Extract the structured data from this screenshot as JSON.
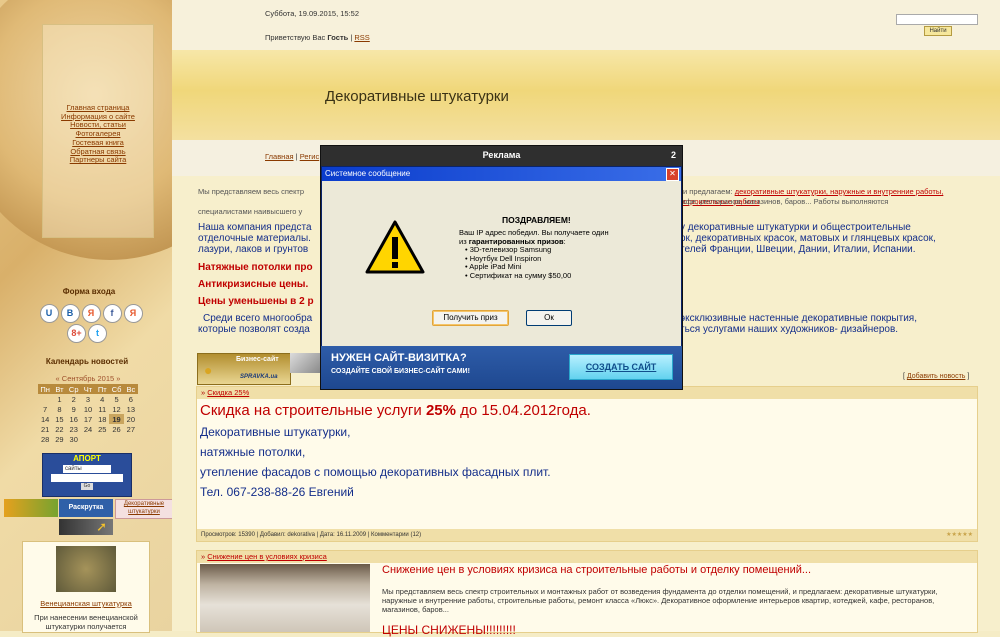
{
  "header": {
    "datetime": "Суббота, 19.09.2015, 15:52",
    "greeting_prefix": "Приветствую Вас",
    "greeting_user": "Гость",
    "sep": "|",
    "rss": "RSS",
    "search_button": "Найти"
  },
  "banner": {
    "title": "Декоративные штукатурки"
  },
  "nav": {
    "home": "Главная",
    "sep": "|",
    "register_partial": "Регис"
  },
  "menu": {
    "items": [
      "Главная страница",
      "Информация о сайте",
      "Новости, статьи",
      "Фотогалерея",
      "Гостевая книга",
      "Обратная связь",
      "Партнеры сайта"
    ]
  },
  "left": {
    "login_title": "Форма входа",
    "social": [
      "U",
      "B",
      "Я",
      "f",
      "Я",
      "8+",
      "t"
    ],
    "calendar_title": "Календарь новостей",
    "calendar_month": "« Сентябрь 2015 »",
    "calendar_days": [
      "Пн",
      "Вт",
      "Ср",
      "Чт",
      "Пт",
      "Сб",
      "Вс"
    ],
    "calendar_weeks": [
      [
        "",
        "1",
        "2",
        "3",
        "4",
        "5",
        "6"
      ],
      [
        "7",
        "8",
        "9",
        "10",
        "11",
        "12",
        "13"
      ],
      [
        "14",
        "15",
        "16",
        "17",
        "18",
        "19",
        "20"
      ],
      [
        "21",
        "22",
        "23",
        "24",
        "25",
        "26",
        "27"
      ],
      [
        "28",
        "29",
        "30",
        "",
        "",
        "",
        ""
      ]
    ],
    "aport_title": "АПОРТ",
    "aport_select": "сайты",
    "aport_go": "Go",
    "banner_links": [
      "Раскрутка",
      "Декоративные штукатурки"
    ],
    "photo_caption": "Венецианская штукатурка",
    "photo_text": "При нанесении венецианской штукатурки получается"
  },
  "content": {
    "intro": "Мы представляем весь спектр",
    "intro_right": "и предлагаем:",
    "intro_links": "декоративные штукатурки, наружные и внутренние работы, строительные работы",
    "intro_tail": "кафе, ресторанов, магазинов, баров... Работы выполняются",
    "intro_line3": "специалистами наивысшего у",
    "company": "Наша компания предста",
    "company_right": "у декоративные штукатурки и общестроительные",
    "company_l2": "отделочные материалы.",
    "company_l2_right": "ок, декоративных красок, матовых и глянцевых красок,",
    "company_l3": "лазури, лаков и грунтов",
    "company_l3_right": "телей Франции, Швеции, Дании, Италии, Испании.",
    "red1": "Натяжные потолки про",
    "red2": "Антикризисные цены.",
    "red3": "Цены уменьшены в 2 р",
    "blue_p1": "Среди всего многообра",
    "blue_p1_right": "эксклюзивные настенные декоративные покрытия,",
    "blue_p2": "которые позволят созда",
    "blue_p2_right": "ться услугами наших художников- дизайнеров.",
    "badge_title": "Бизнес-сайт",
    "badge_sub": "SPRAVKA.ua",
    "add_news": "Добавить новость",
    "news1": {
      "title": "Скидка 25%",
      "headline_a": "Скидка на строительные услуги",
      "headline_b": "25%",
      "headline_c": "до 15.04.2012года.",
      "lines": [
        "Декоративные штукатурки,",
        "натяжные потолки,",
        "утепление фасадов с помощью декоративных фасадных плит.",
        "Тел. 067-238-88-26 Евгений"
      ],
      "footer": "Просмотров: 15390 | Добавил: dekorativa | Дата: 16.11.2009 | Комментарии (12)",
      "rating": "★★★★★"
    },
    "news2": {
      "title": "Снижение цен в условиях кризиса",
      "headline": "Снижение цен в условиях кризиса на строительные работы и отделку помещений...",
      "text": "Мы представляем весь спектр строительных и монтажных работ от возведения фундамента до отделки помещений, и предлагаем: декоративные штукатурки, наружные и внутренние работы, строительные работы, ремонт класса «Люкс». Декоративное оформление интерьеров квартир, котеджей, кафе, ресторанов, магазинов, баров...",
      "partial": "ЦЕНЫ СНИЖЕНЫ!!!!!!!!!"
    }
  },
  "modal": {
    "title": "Реклама",
    "counter": "2",
    "window_title": "Системное сообщение",
    "close": "✕",
    "congrats": "ПОЗДРАВЛЯЕМ!",
    "line1": "Ваш IP адрес победил. Вы получаете один",
    "line2_prefix": "из",
    "line2_bold": "гарантированных призов",
    "line2_suffix": ":",
    "prizes": [
      "• 3D-телевизор Samsung",
      "• Ноутбук Dell Inspiron",
      "• Apple iPad Mini",
      "• Сертификат на сумму $50,00"
    ],
    "get_prize": "Получить приз",
    "ok": "Ок",
    "promo_title": "НУЖЕН САЙТ-ВИЗИТКА?",
    "promo_sub": "СОЗДАЙТЕ СВОЙ БИЗНЕС-САЙТ САМИ!",
    "promo_button": "СОЗДАТЬ САЙТ"
  }
}
